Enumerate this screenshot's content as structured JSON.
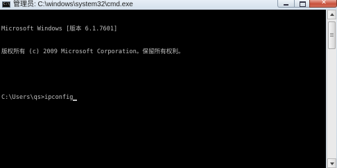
{
  "window": {
    "title": "管理员: C:\\windows\\system32\\cmd.exe",
    "app_icon_text": "C:\\"
  },
  "controls": {
    "close_glyph": "✕"
  },
  "console": {
    "lines": [
      "Microsoft Windows [版本 6.1.7601]",
      "版权所有 (c) 2009 Microsoft Corporation。保留所有权利。",
      "",
      "C:\\Users\\qs>ipconfig"
    ]
  },
  "colors": {
    "console_background": "#000000",
    "console_text": "#c0c0c0",
    "close_button": "#c8503c"
  },
  "icons": {
    "app": "cmd-console-icon",
    "minimize": "minimize-icon",
    "maximize": "maximize-icon",
    "close": "close-icon",
    "scroll_up": "arrow-up-icon",
    "scroll_down": "arrow-down-icon"
  }
}
